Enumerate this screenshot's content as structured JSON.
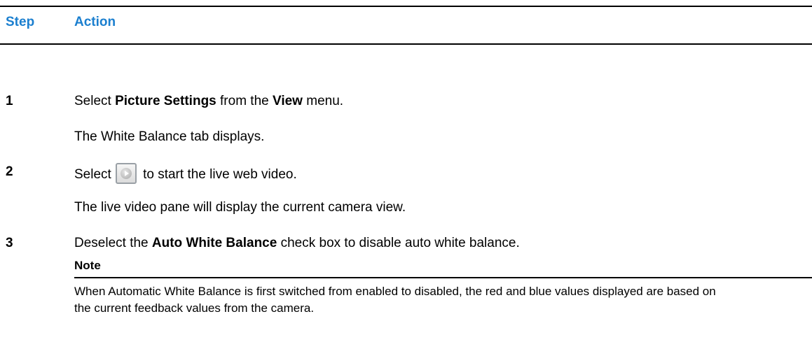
{
  "table": {
    "header": {
      "step": "Step",
      "action": "Action"
    },
    "colors": {
      "header_text": "#1b7fcf",
      "rules": "#000000"
    },
    "rows": [
      {
        "step": "1",
        "action_pre": "Select ",
        "action_bold1": "Picture Settings",
        "action_mid": " from the ",
        "action_bold2": "View",
        "action_post": " menu.",
        "result": "The White Balance tab displays."
      },
      {
        "step": "2",
        "action_pre": "Select",
        "icon": "play-button-icon",
        "action_post": " to start the live web video.",
        "result": "The live video pane will display the current camera view."
      },
      {
        "step": "3",
        "action_pre": "Deselect the ",
        "action_bold1": "Auto White Balance",
        "action_post": " check box to disable auto white balance."
      }
    ]
  },
  "note": {
    "title": "Note",
    "text": "When Automatic White Balance is first switched from enabled to disabled, the red and blue values displayed are based on the current feedback values from the camera."
  }
}
